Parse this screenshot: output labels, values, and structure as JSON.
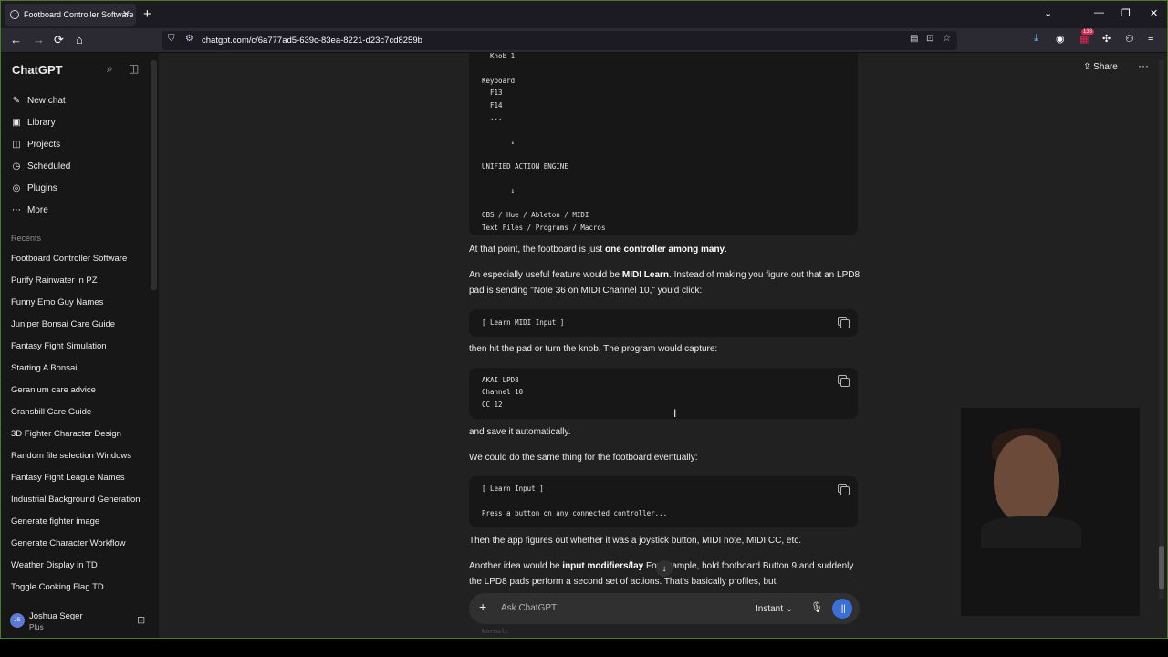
{
  "browser": {
    "tab_title": "Footboard Controller Software",
    "tab_close": "✕",
    "new_tab": "+",
    "url": "chatgpt.com/c/6a777ad5-639c-83ea-8221-d23c7cd8259b",
    "notification_count": "138",
    "window_controls": [
      "⌄",
      "—",
      "❐",
      "✕"
    ],
    "nav_icons": [
      "←",
      "→",
      "⟳",
      "⌂"
    ]
  },
  "sidebar": {
    "brand": "ChatGPT",
    "nav": [
      {
        "label": "New chat",
        "icon": "✎"
      },
      {
        "label": "Library",
        "icon": "▣"
      },
      {
        "label": "Projects",
        "icon": "◫"
      },
      {
        "label": "Scheduled",
        "icon": "◷"
      },
      {
        "label": "Plugins",
        "icon": "◎"
      },
      {
        "label": "More",
        "icon": "⋯"
      }
    ],
    "recents_label": "Recents",
    "recents": [
      "Footboard Controller Software",
      "Purify Rainwater in PZ",
      "Funny Emo Guy Names",
      "Juniper Bonsai Care Guide",
      "Fantasy Fight Simulation",
      "Starting A Bonsai",
      "Geranium care advice",
      "Cransbill Care Guide",
      "3D Fighter Character Design",
      "Random file selection Windows",
      "Fantasy Fight League Names",
      "Industrial Background Generation",
      "Generate fighter image",
      "Generate Character Workflow",
      "Weather Display in TD",
      "Toggle Cooking Flag TD"
    ],
    "user": {
      "name": "Joshua Seger",
      "plan": "Plus",
      "initials": "JS"
    }
  },
  "header": {
    "share_label": "Share",
    "menu_icon": "···"
  },
  "conversation": {
    "code1": "  Knob 1\n\nKeyboard\n  F13\n  F14\n  ...\n\n       ↓\n\nUNIFIED ACTION ENGINE\n\n       ↓\n\nOBS / Hue / Ableton / MIDI\nText Files / Programs / Macros",
    "p1_a": "At that point, the footboard is just ",
    "p1_b": "one controller among many",
    "p1_c": ".",
    "p2_a": "An especially useful feature would be ",
    "p2_b": "MIDI Learn",
    "p2_c": ". Instead of making you figure out that an LPD8 pad is sending \"Note 36 on MIDI Channel 10,\" you'd click:",
    "code2": "[ Learn MIDI Input ]",
    "p3": "then hit the pad or turn the knob. The program would capture:",
    "code3": "AKAI LPD8\nChannel 10\nCC 12",
    "p4": "and save it automatically.",
    "p5": "We could do the same thing for the footboard eventually:",
    "code4": "[ Learn Input ]\n\nPress a button on any connected controller...",
    "p6": "Then the app figures out whether it was a joystick button, MIDI note, MIDI CC, etc.",
    "p7_a": "Another idea would be ",
    "p7_b": "input modifiers/lay",
    "p7_c": " For example, hold footboard Button 9 and suddenly the LPD8 pads perform a second set of actions. That's basically profiles, but",
    "below_composer": "Normal:"
  },
  "composer": {
    "placeholder": "Ask ChatGPT",
    "mode": "Instant",
    "mode_caret": "⌄"
  }
}
